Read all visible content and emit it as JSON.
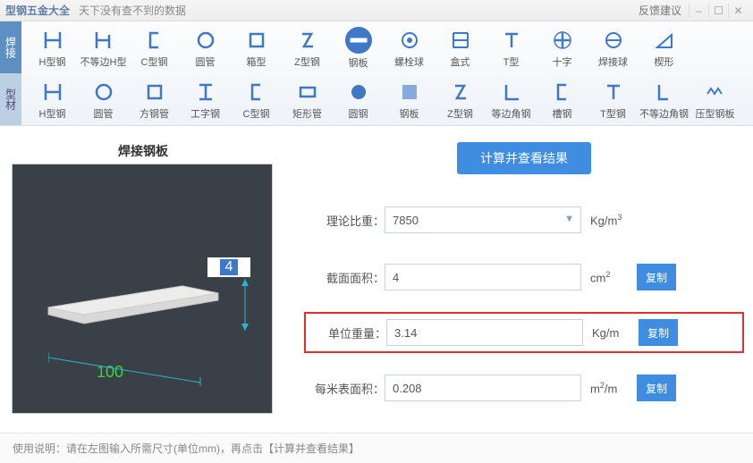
{
  "titlebar": {
    "app": "型钢五金大全",
    "slogan": "天下没有查不到的数据",
    "feedback": "反馈建议"
  },
  "sideTabs": {
    "top": "焊接",
    "bottom": "型材"
  },
  "row1": [
    {
      "id": "hxing",
      "label": "H型钢"
    },
    {
      "id": "budengh",
      "label": "不等边H型"
    },
    {
      "id": "cxing",
      "label": "C型钢"
    },
    {
      "id": "yuanguan",
      "label": "圆管"
    },
    {
      "id": "xiangxing",
      "label": "箱型"
    },
    {
      "id": "zxing",
      "label": "Z型钢"
    },
    {
      "id": "gangban",
      "label": "钢板",
      "active": true
    },
    {
      "id": "luoshuan",
      "label": "螺栓球"
    },
    {
      "id": "heshi",
      "label": "盒式"
    },
    {
      "id": "txing",
      "label": "T型"
    },
    {
      "id": "shizi",
      "label": "十字"
    },
    {
      "id": "hanjieqiu",
      "label": "焊接球"
    },
    {
      "id": "xiexing",
      "label": "楔形"
    }
  ],
  "row2": [
    {
      "id": "hxing2",
      "label": "H型钢"
    },
    {
      "id": "yuanguan2",
      "label": "圆管"
    },
    {
      "id": "fangguan",
      "label": "方钢管"
    },
    {
      "id": "gongzi",
      "label": "工字钢"
    },
    {
      "id": "cxing2",
      "label": "C型钢"
    },
    {
      "id": "juxing",
      "label": "矩形管"
    },
    {
      "id": "yuangang",
      "label": "圆钢"
    },
    {
      "id": "gangban2",
      "label": "钢板"
    },
    {
      "id": "zxing2",
      "label": "Z型钢"
    },
    {
      "id": "dengbian",
      "label": "等边角钢"
    },
    {
      "id": "caoshi",
      "label": "槽钢"
    },
    {
      "id": "txing2",
      "label": "T型钢"
    },
    {
      "id": "budengbian",
      "label": "不等边角钢"
    },
    {
      "id": "yaxing",
      "label": "压型钢板"
    }
  ],
  "left": {
    "title": "焊接钢板",
    "dim_thickness": "4",
    "dim_length": "100"
  },
  "calcButton": "计算并查看结果",
  "fields": {
    "density": {
      "label": "理论比重：",
      "value": "7850",
      "unit": "Kg/m",
      "sup": "3"
    },
    "area": {
      "label": "截面面积：",
      "value": "4",
      "unit": "cm",
      "sup": "2",
      "copy": "复制"
    },
    "unitWeight": {
      "label": "单位重量：",
      "value": "3.14",
      "unit": "Kg/m",
      "copy": "复制"
    },
    "surface": {
      "label": "每米表面积：",
      "value": "0.208",
      "unit": "m",
      "sup": "2",
      "unit2": "/m",
      "copy": "复制"
    }
  },
  "footer": "使用说明：请在左图输入所需尺寸(单位mm)，再点击【计算并查看结果】"
}
